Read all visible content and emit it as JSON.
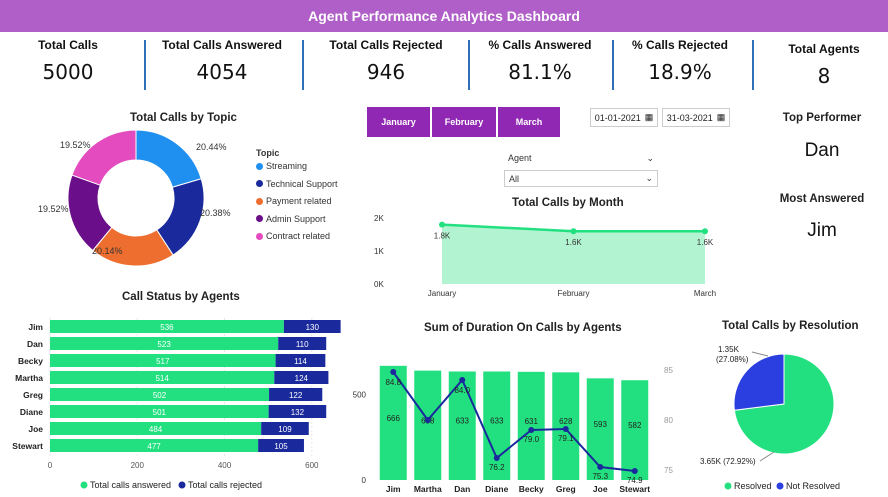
{
  "header": {
    "title": "Agent Performance Analytics Dashboard"
  },
  "kpis": [
    {
      "label": "Total Calls",
      "value": "5000"
    },
    {
      "label": "Total Calls Answered",
      "value": "4054"
    },
    {
      "label": "Total Calls Rejected",
      "value": "946"
    },
    {
      "label": "% Calls Answered",
      "value": "81.1%"
    },
    {
      "label": "% Calls Rejected",
      "value": "18.9%"
    },
    {
      "label": "Total Agents",
      "value": "8"
    }
  ],
  "filters": {
    "months": [
      "January",
      "February",
      "March"
    ],
    "date_start": "01-01-2021",
    "date_end": "31-03-2021",
    "agent_label": "Agent",
    "agent_value": "All"
  },
  "performers": {
    "top_label": "Top Performer",
    "top_value": "Dan",
    "most_label": "Most Answered",
    "most_value": "Jim"
  },
  "colors": {
    "accent": "#b05fc8",
    "month_button": "#9128b3",
    "green": "#22e07f",
    "navy": "#1a2a9c",
    "kpi_separator": "#2f6fb5"
  },
  "chart_data": [
    {
      "type": "pie",
      "title": "Total Calls by Topic",
      "legend_title": "Topic",
      "categories": [
        "Streaming",
        "Technical Support",
        "Payment related",
        "Admin Support",
        "Contract related"
      ],
      "values": [
        20.44,
        20.38,
        20.14,
        19.52,
        19.52
      ],
      "labels": [
        "20.44%",
        "20.38%",
        "20.14%",
        "19.52%",
        "19.52%"
      ],
      "colors": [
        "#1f8ff0",
        "#1a2a9c",
        "#ee6e30",
        "#6b0e8a",
        "#e34bbf"
      ],
      "donut": true
    },
    {
      "type": "area",
      "title": "Total Calls by Month",
      "categories": [
        "January",
        "February",
        "March"
      ],
      "values": [
        1.8,
        1.6,
        1.6
      ],
      "labels": [
        "1.8K",
        "1.6K",
        "1.6K"
      ],
      "y_ticks": [
        "0K",
        "1K",
        "2K"
      ],
      "ylim": [
        0,
        2
      ],
      "colors": [
        "#22e07f"
      ]
    },
    {
      "type": "bar",
      "orientation": "horizontal",
      "stacked": true,
      "title": "Call Status by Agents",
      "categories": [
        "Jim",
        "Dan",
        "Becky",
        "Martha",
        "Greg",
        "Diane",
        "Joe",
        "Stewart"
      ],
      "series": [
        {
          "name": "Total calls answered",
          "values": [
            536,
            523,
            517,
            514,
            502,
            501,
            484,
            477
          ],
          "color": "#22e07f"
        },
        {
          "name": "Total calls rejected",
          "values": [
            130,
            110,
            114,
            124,
            122,
            132,
            109,
            105
          ],
          "color": "#1a2a9c"
        }
      ],
      "x_ticks": [
        "0",
        "200",
        "400",
        "600"
      ],
      "xlim": [
        0,
        660
      ]
    },
    {
      "type": "bar",
      "title": "Sum of Duration On Calls by Agents",
      "categories": [
        "Jim",
        "Martha",
        "Dan",
        "Diane",
        "Becky",
        "Greg",
        "Joe",
        "Stewart"
      ],
      "series": [
        {
          "name": "Sum of Duration",
          "values": [
            666,
            638,
            633,
            633,
            631,
            628,
            593,
            582
          ],
          "color": "#22e07f"
        },
        {
          "name": "Average",
          "type": "line",
          "values": [
            84.8,
            80.0,
            84.0,
            76.2,
            79.0,
            79.1,
            75.3,
            74.9
          ],
          "color": "#1a2a9c"
        }
      ],
      "bar_labels": [
        "666",
        "638",
        "633",
        "633",
        "631",
        "628",
        "593",
        "582"
      ],
      "line_labels": [
        "84.8",
        "",
        "84.0",
        "76.2",
        "79.0",
        "79.1",
        "75.3",
        "74.9"
      ],
      "y_ticks_left": [
        "0",
        "500"
      ],
      "ylim_left": [
        0,
        700
      ],
      "y_ticks_right": [
        "75",
        "80",
        "85"
      ],
      "ylim_right": [
        74,
        86
      ]
    },
    {
      "type": "pie",
      "title": "Total Calls by Resolution",
      "categories": [
        "Resolved",
        "Not Resolved"
      ],
      "values": [
        3650,
        1350
      ],
      "labels": [
        "3.65K (72.92%)",
        "1.35K (27.08%)"
      ],
      "colors": [
        "#22e07f",
        "#2b3fe0"
      ]
    }
  ]
}
